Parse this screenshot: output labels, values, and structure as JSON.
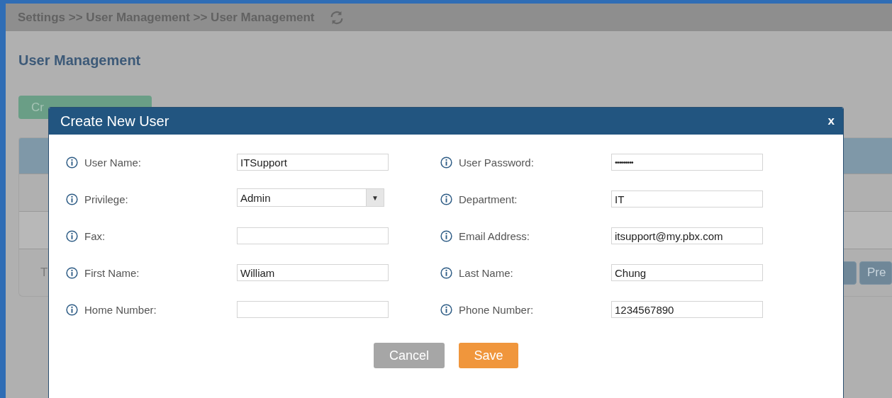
{
  "breadcrumb": "Settings >> User Management >> User Management",
  "page_title": "User Management",
  "background": {
    "create_button": "Cr",
    "table_text": "T",
    "pager_button": "Pre"
  },
  "dialog": {
    "title": "Create New User",
    "close": "x",
    "fields": [
      {
        "label": "User Name:",
        "kind": "text",
        "value": "ITSupport"
      },
      {
        "label": "User Password:",
        "kind": "password",
        "value": "•••••••••"
      },
      {
        "label": "Privilege:",
        "kind": "select",
        "value": "Admin",
        "caret": "▼"
      },
      {
        "label": "Department:",
        "kind": "text",
        "value": "IT"
      },
      {
        "label": "Fax:",
        "kind": "text"
      },
      {
        "label": "Email Address:",
        "kind": "text",
        "value": "itsupport@my.pbx.com"
      },
      {
        "label": "First Name:",
        "kind": "text",
        "value": "William"
      },
      {
        "label": "Last Name:",
        "kind": "text",
        "value": "Chung"
      },
      {
        "label": "Home Number:",
        "kind": "text"
      },
      {
        "label": "Phone Number:",
        "kind": "text",
        "value": "1234567890"
      }
    ],
    "buttons": [
      {
        "label": "Cancel",
        "kind": "secondary"
      },
      {
        "label": "Save",
        "kind": "primary"
      }
    ]
  }
}
